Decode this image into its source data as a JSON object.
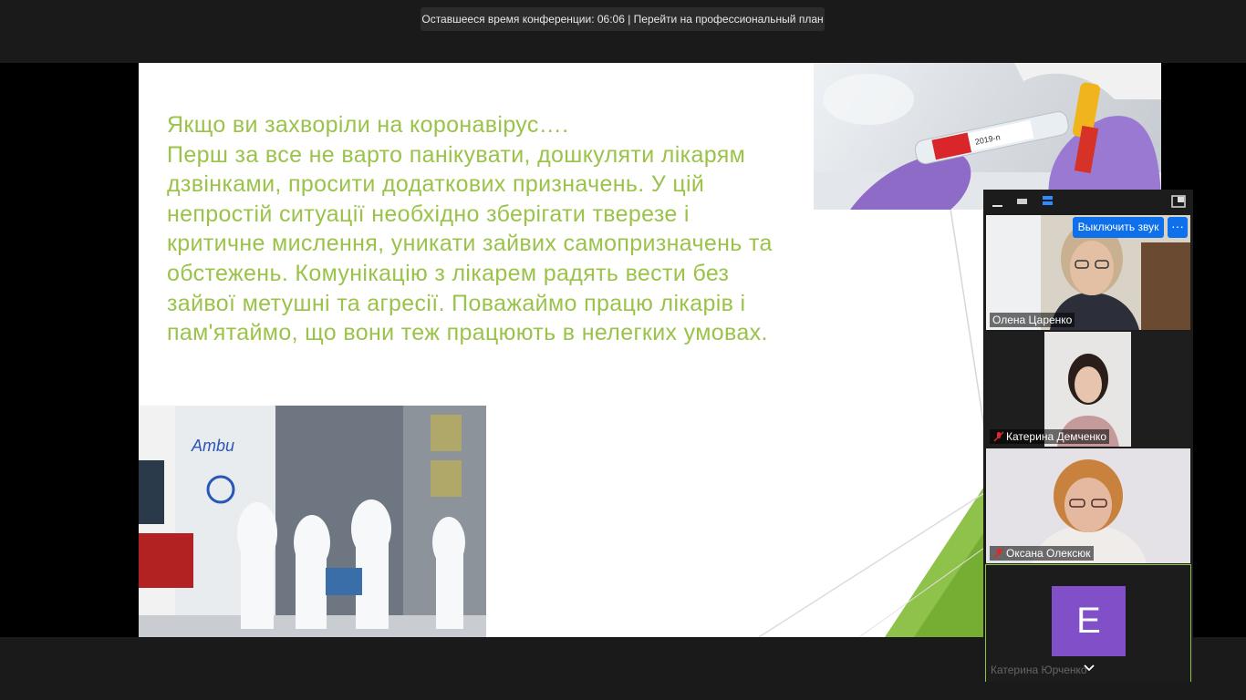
{
  "meeting": {
    "timer_text": "Оставшееся время конференции: 06:06 | Перейти на профессиональный план"
  },
  "slide": {
    "lines": [
      "Якщо ви захворіли на коронавірус….",
      "Перш за все не варто панікувати, дошкуляти лікарям",
      "дзвінками, просити додаткових призначень. У цій",
      "непростій ситуації необхідно зберігати тверезе і",
      "критичне мислення, уникати зайвих самопризначень та",
      "обстежень. Комунікацію з лікарем радять вести без",
      "зайвої метушні та агресії. Поважаймо працю лікарів і",
      "пам'ятаймо, що вони теж працюють в нелегких умовах."
    ],
    "ambulance_sign": "Ambu",
    "tube_label": "2019-n",
    "accent_color": "#9bc34a"
  },
  "panel": {
    "icons": [
      "minimize-icon",
      "hide-video-icon",
      "speaker-view-icon",
      "float-view-icon"
    ],
    "participants": [
      {
        "name": "Олена Царенко",
        "muted": false
      },
      {
        "name": "Катерина Демченко",
        "muted": true
      },
      {
        "name": "Оксана Олексюк",
        "muted": true
      },
      {
        "name": "Катерина Юрченко",
        "muted": false,
        "avatar_letter": "E",
        "avatar_color": "#8150c9",
        "active_speaker": true
      }
    ],
    "mute_label": "Выключить звук",
    "more_label": "···"
  }
}
